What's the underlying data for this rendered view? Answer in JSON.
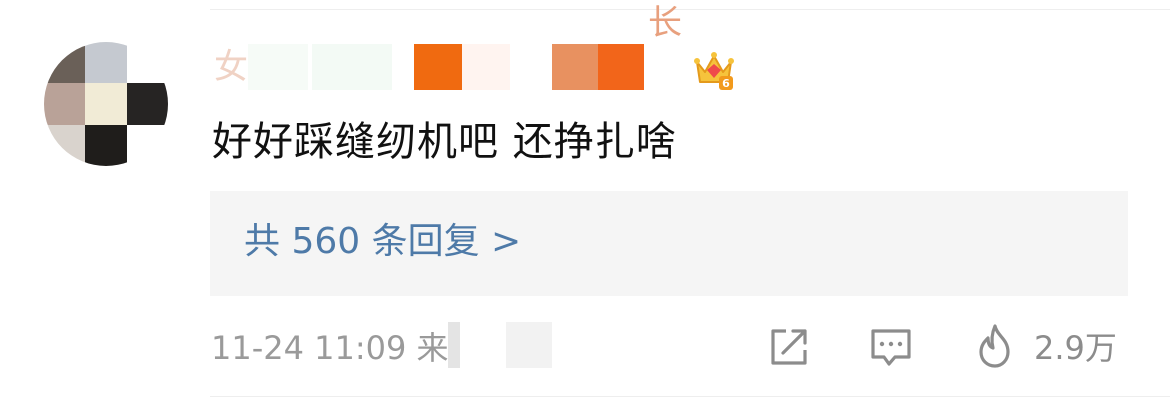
{
  "comment": {
    "username_visible_first": "女",
    "username_visible_last": "长",
    "user_level": "6",
    "text": "好好踩缝纫机吧 还挣扎啥",
    "replies_label": "共 560 条回复 >",
    "timestamp": "11-24 11:09",
    "source_prefix": "来",
    "likes": "2.9万"
  },
  "icons": {
    "crown": "vip-crown-icon",
    "share": "share-icon",
    "comment": "comment-icon",
    "like": "flame-like-icon"
  },
  "colors": {
    "reply_link": "#4e7aa8",
    "meta_text": "#9a9a9a",
    "reply_bg": "#f5f5f5",
    "name_mosaic_orange": "#f06a10"
  }
}
